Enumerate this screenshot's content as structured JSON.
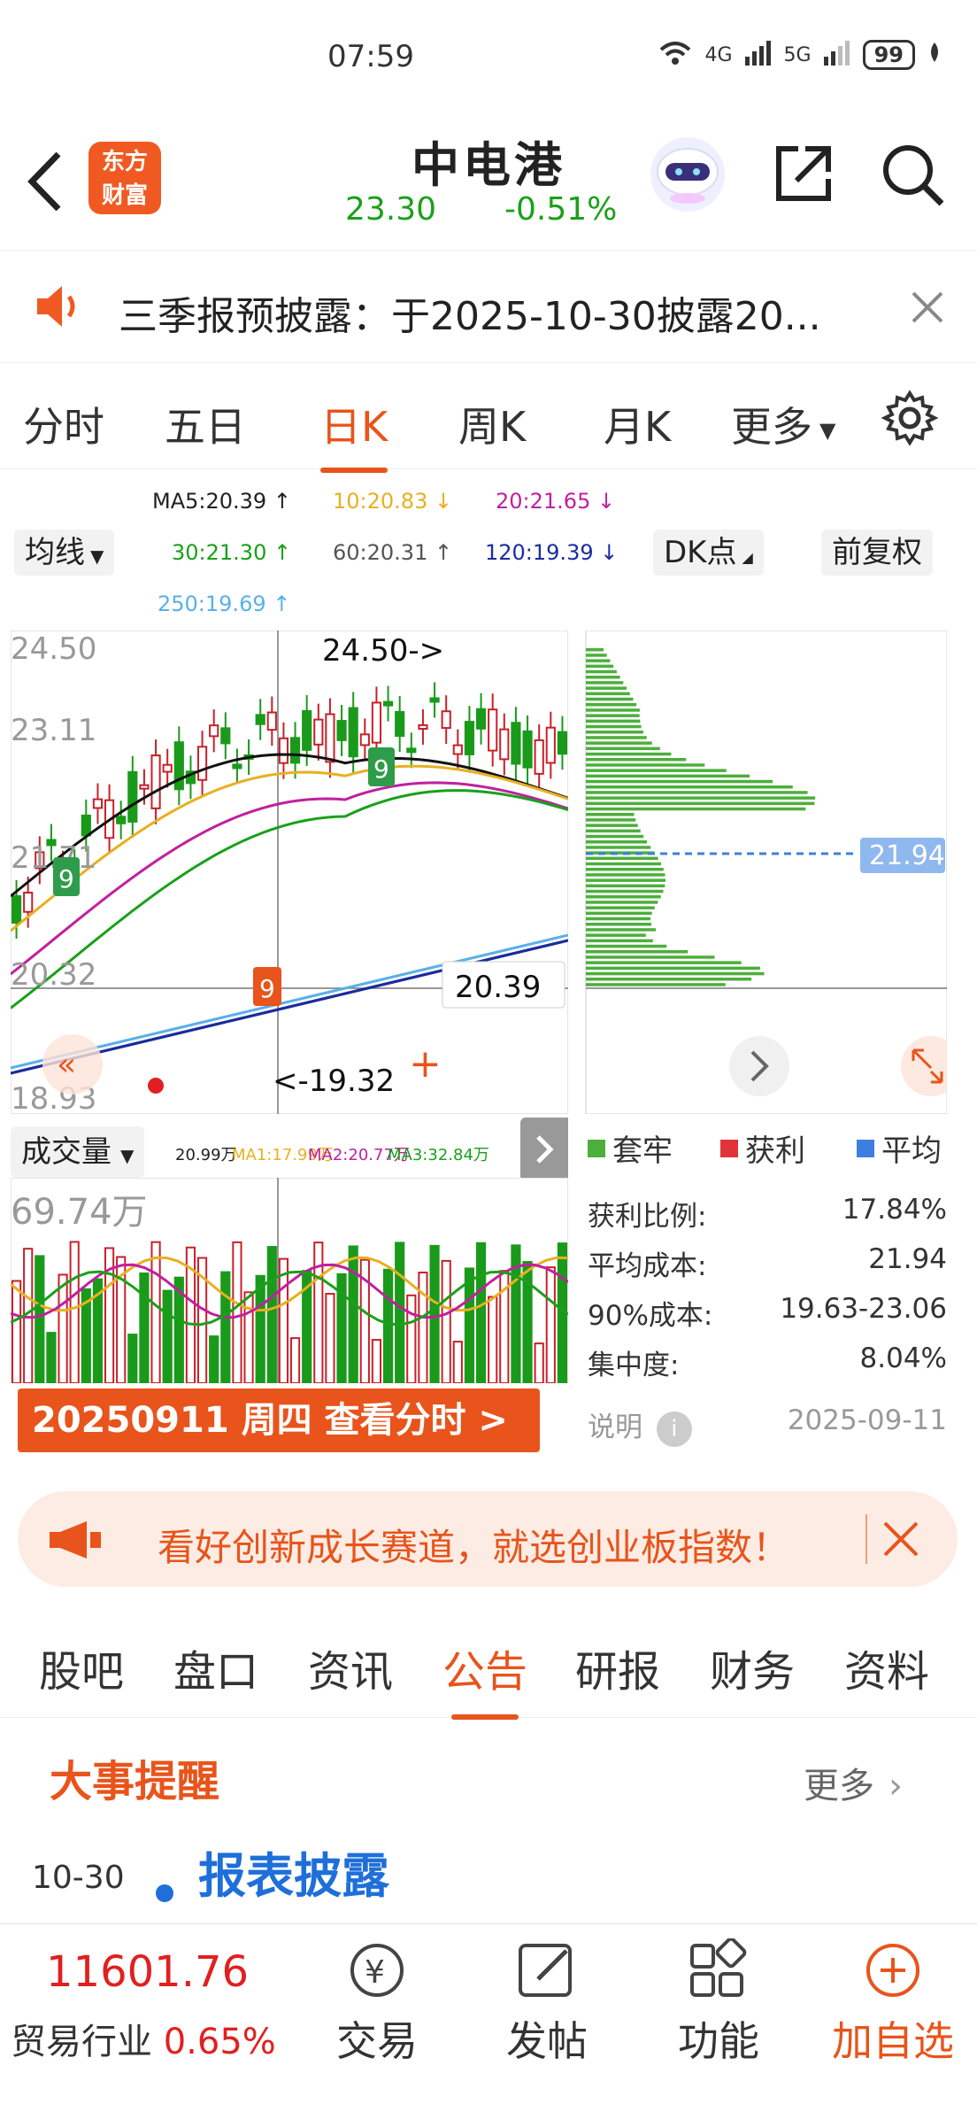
{
  "status_bar": {
    "time": "07:59",
    "signal_1": "6",
    "signal_2": "4G",
    "signal_3": "5G",
    "battery": "99"
  },
  "header": {
    "logo_line1": "东方",
    "logo_line2": "财富",
    "title": "中电港",
    "price": "23.30",
    "change_pct": "-0.51%"
  },
  "notice": {
    "text": "三季报预披露：于2025-10-30披露20..."
  },
  "period_tabs": [
    "分时",
    "五日",
    "日K",
    "周K",
    "月K",
    "更多"
  ],
  "active_period": "日K",
  "ma_select": "均线",
  "ma_legend": {
    "ma5": "MA5:20.39 ↑",
    "ma10": "10:20.83 ↓",
    "ma20": "20:21.65 ↓",
    "ma30": "30:21.30 ↑",
    "ma60": "60:20.31 ↑",
    "ma120": "120:19.39 ↓",
    "ma250": "250:19.69 ↑"
  },
  "dk_button": "DK点",
  "adjust_button": "前复权",
  "kchart": {
    "price_labels": [
      "24.50",
      "23.11",
      "21.71",
      "20.32",
      "18.93"
    ],
    "high_mark": "24.50->",
    "low_mark": "<-19.32",
    "crosshair_value": "20.39",
    "td_badges": [
      "9",
      "9",
      "9"
    ]
  },
  "chip": {
    "avg_label": "21.94",
    "legend": [
      "套牢",
      "获利",
      "平均"
    ],
    "rows": [
      {
        "label": "获利比例:",
        "value": "17.84%"
      },
      {
        "label": "平均成本:",
        "value": "21.94"
      },
      {
        "label": "90%成本:",
        "value": "19.63-23.06"
      },
      {
        "label": "集中度:",
        "value": "8.04%"
      }
    ],
    "note_label": "说明",
    "note_date": "2025-09-11",
    "colors": {
      "trapped": "#4caf3b",
      "profit": "#e0343a",
      "average": "#3d7fe0"
    }
  },
  "volume": {
    "select": "成交量",
    "legend": {
      "v": "20.99万",
      "ma1": "MA1:17.99万",
      "ma2": "MA2:20.77万",
      "ma3": "MA3:32.84万"
    },
    "max_label": "69.74万",
    "date_button": "20250911  周四  查看分时  >"
  },
  "ad": {
    "text": "看好创新成长赛道，就选创业板指数！"
  },
  "content_tabs": [
    "股吧",
    "盘口",
    "资讯",
    "公告",
    "研报",
    "财务",
    "资料"
  ],
  "active_content_tab": "公告",
  "events": {
    "title": "大事提醒",
    "more": "更多",
    "date": "10-30",
    "event_name": "报表披露"
  },
  "bottom_bar": {
    "index_value": "11601.76",
    "index_name": "贸易行业",
    "index_change": "0.65%",
    "nav": [
      "交易",
      "发帖",
      "功能",
      "加自选"
    ]
  },
  "colors": {
    "accent": "#e8541b",
    "up": "#e02020",
    "down": "#1aa01a"
  }
}
